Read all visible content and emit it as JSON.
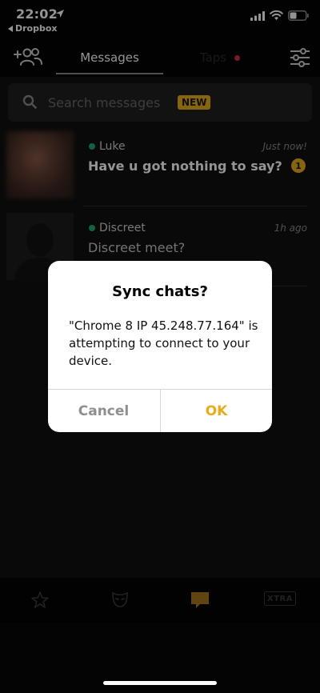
{
  "status_bar": {
    "time": "22:02",
    "back_app": "Dropbox"
  },
  "top_nav": {
    "tabs": [
      {
        "label": "Messages",
        "active": true
      },
      {
        "label": "Taps",
        "active": false,
        "indicator_color": "#d02f42"
      }
    ]
  },
  "search": {
    "placeholder": "Search messages",
    "badge": "NEW"
  },
  "conversations": [
    {
      "name": "Luke",
      "time": "Just now!",
      "message": "Have u got nothing to say?",
      "unread": "1",
      "online": true
    },
    {
      "name": "Discreet",
      "time": "1h ago",
      "message": "Discreet meet?",
      "online": true
    }
  ],
  "dialog": {
    "title": "Sync chats?",
    "message": "\"Chrome 8 IP 45.248.77.164\" is attempting to connect to your device.",
    "cancel_label": "Cancel",
    "ok_label": "OK"
  },
  "bottom_bar": {
    "tabs": [
      {
        "icon": "star-icon"
      },
      {
        "icon": "mask-icon"
      },
      {
        "icon": "chat-icon",
        "active": true
      },
      {
        "icon": "xtra-icon",
        "label": "XTRA"
      }
    ]
  },
  "colors": {
    "accent": "#e8ac1b",
    "online": "#1fa774",
    "background": "#101010"
  }
}
